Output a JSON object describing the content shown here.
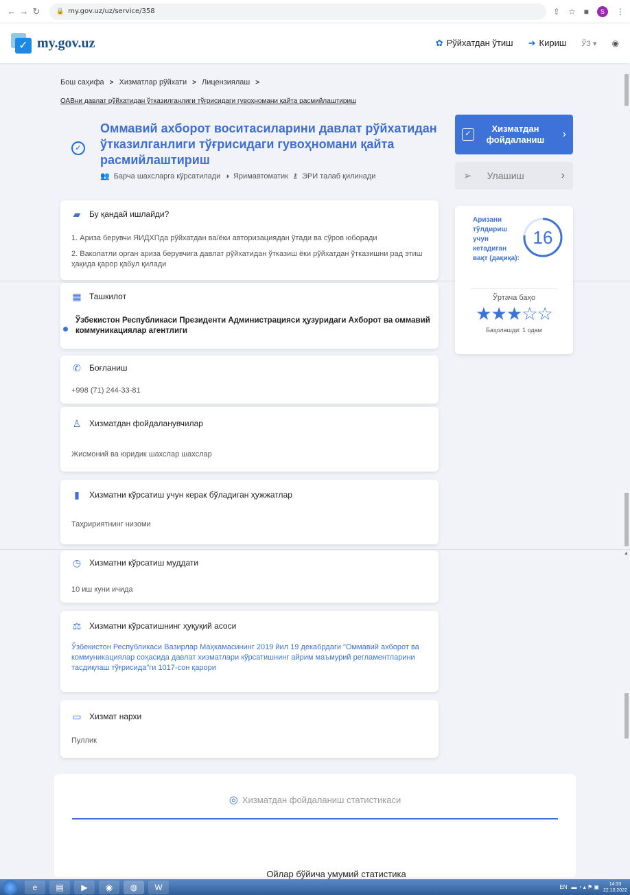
{
  "browser": {
    "url": "my.gov.uz/uz/service/358"
  },
  "header": {
    "logo_text": "my.gov.uz",
    "register_label": "Рўйхатдан ўтиш",
    "login_label": "Кириш",
    "lang_label": "ЎЗ ▾"
  },
  "breadcrumb": {
    "items": [
      "Бош саҳифа",
      "Хизматлар рўйхати",
      "Лицензиялаш"
    ],
    "current": "ОАВни давлат рўйхатидан ўтказилганлиги тўғрисидаги гувоҳномани қайта расмийлаштириш"
  },
  "service": {
    "title": "Оммавий ахборот воситасиларини давлат рўйхатидан ўтказилганлиги тўғрисидаги гувоҳномани қайта расмийлаштириш",
    "meta_audience": "Барча шахсларга кўрсатилади",
    "meta_mode": "Яримавтоматик",
    "meta_eri": "ЭРИ талаб қилинади"
  },
  "actions": {
    "use_label": "Хизматдан фойдаланиш",
    "share_label": "Улашиш"
  },
  "how": {
    "title": "Бу қандай ишлайди?",
    "step1": "1. Ариза берувчи ЯИДХПда рўйхатдан ва/ёки авторизациядан ўтади ва сўров юборади",
    "step2": "2. Ваколатли орган ариза берувчига давлат рўйхатидан ўтказиш ёки рўйхатдан ўтказишни рад этиш ҳақида қарор қабул қилади"
  },
  "side": {
    "time_label": "Аризани тўлдириш учун кетадиган вақт (дақиқа):",
    "time_value": "16",
    "avg_label": "Ўртача баҳо",
    "rating": 3,
    "rating_max": 5,
    "raters": "Баҳолашди: 1 одам"
  },
  "org": {
    "title": "Ташкилот",
    "name": "Ўзбекистон Республикаси Президенти Администрацияси ҳузуридаги Ахборот ва оммавий коммуникациялар агентлиги"
  },
  "contact": {
    "title": "Боғланиш",
    "phone": "+998 (71) 244-33-81"
  },
  "users": {
    "title": "Хизматдан фойдаланувчилар",
    "value": "Жисмоний ва юридик шахслар шахслар"
  },
  "docs": {
    "title": "Хизматни кўрсатиш учун керак бўладиган ҳужжатлар",
    "value": "Таҳририятнинг низоми"
  },
  "term": {
    "title": "Хизматни кўрсатиш муддати",
    "value": "10 иш куни ичида"
  },
  "legal": {
    "title": "Хизматни кўрсатишнинг ҳуқуқий асоси",
    "value": "Ўзбекистон Республикаси Вазирлар Маҳкамасининг 2019 йил 19 декабрдаги \"Оммавий ахборот ва коммуникациялар соҳасида давлат хизматлари кўрсатишнинг айрим маъмурий регламентларини тасдиқлаш тўғрисида\"ги 1017-сон қарори"
  },
  "price": {
    "title": "Хизмат нархи",
    "value": "Пуллик"
  },
  "stats": {
    "title": "Хизматдан фойдаланиш статистикаси",
    "subtitle": "Ойлар бўйича умумий статистика"
  },
  "taskbar": {
    "lang": "EN",
    "time": "14:33",
    "date": "22.10.2022"
  },
  "colors": {
    "accent": "#3d73d8",
    "logo": "#1a4f8b"
  }
}
